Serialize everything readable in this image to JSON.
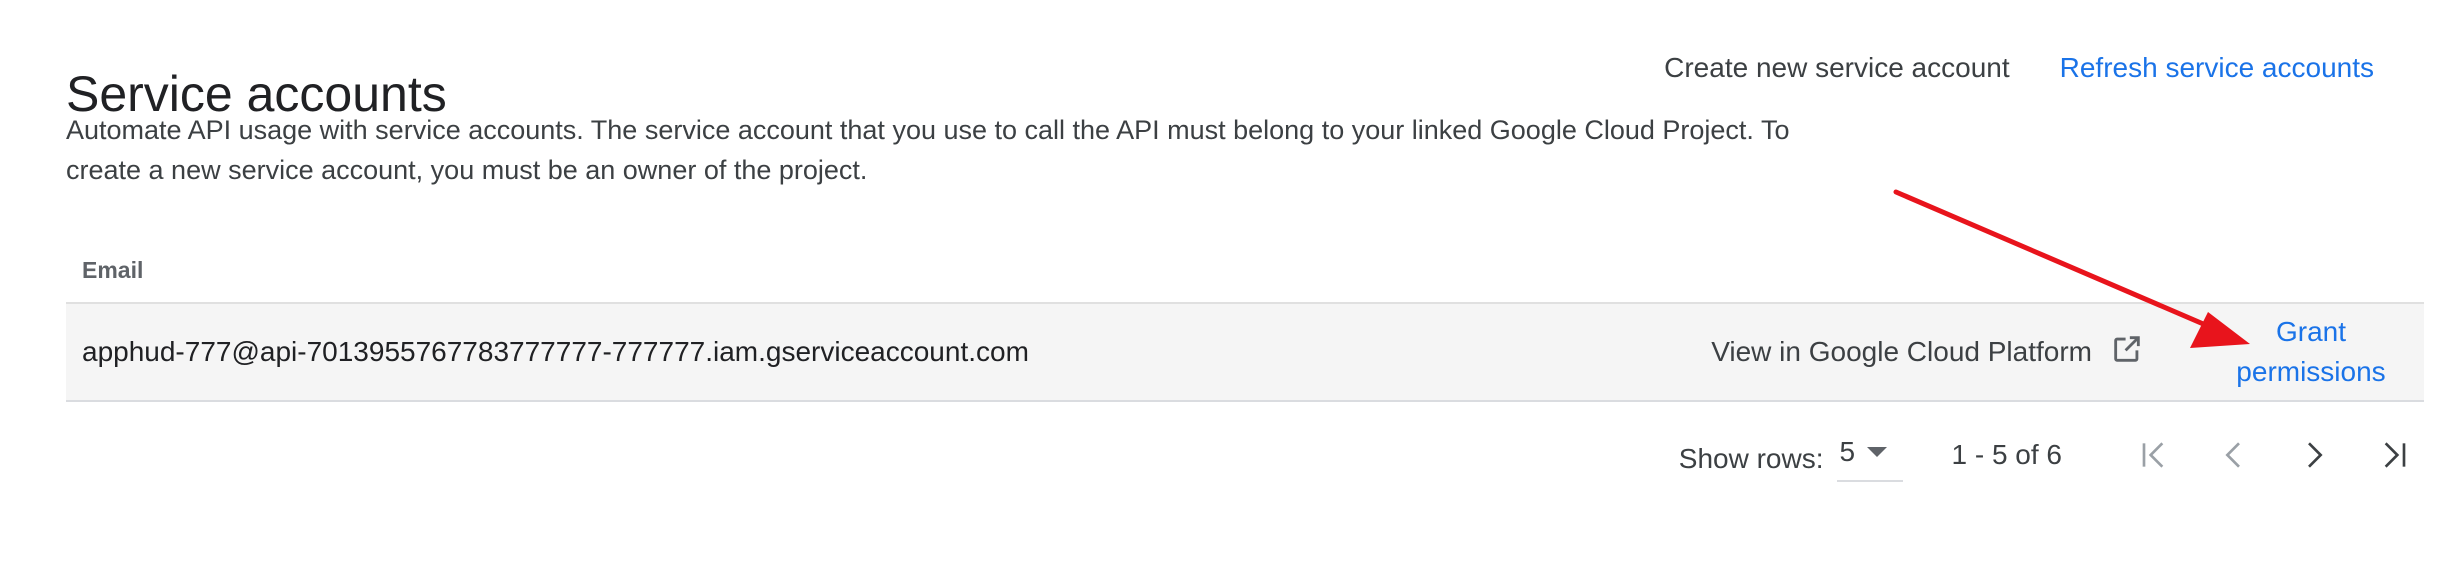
{
  "header": {
    "title": "Service accounts",
    "create_label": "Create new service account",
    "refresh_label": "Refresh service accounts"
  },
  "description": "Automate API usage with service accounts. The service account that you use to call the API must belong to your linked Google Cloud Project. To create a new service account, you must be an owner of the project.",
  "table": {
    "columns": [
      "Email"
    ],
    "rows": [
      {
        "email": "apphud-777@api-7013955767783777777-777777.iam.gserviceaccount.com",
        "view_label": "View in Google Cloud Platform",
        "grant_label": "Grant permissions"
      }
    ]
  },
  "pagination": {
    "rows_label": "Show rows:",
    "rows_value": "5",
    "range": "1 - 5 of 6"
  },
  "icons": {
    "external_link": "open-in-new-icon",
    "first_page": "first-page-icon",
    "prev_page": "chevron-left-icon",
    "next_page": "chevron-right-icon",
    "last_page": "last-page-icon",
    "annotation": "red-arrow-icon"
  },
  "colors": {
    "accent": "#1a73e8",
    "row_background": "#f5f5f5",
    "annotation": "#e8141c"
  }
}
